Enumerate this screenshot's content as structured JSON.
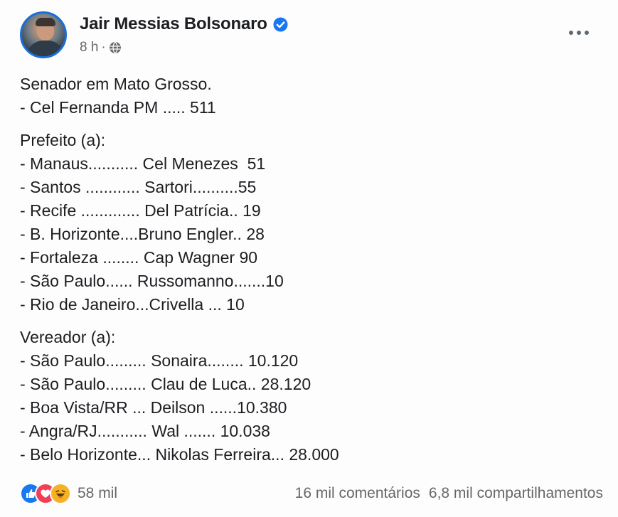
{
  "header": {
    "name": "Jair Messias Bolsonaro",
    "time": "8 h",
    "separator": "·"
  },
  "content": {
    "sections": [
      {
        "title": "Senador em Mato Grosso.",
        "lines": [
          "- Cel Fernanda PM ..... 511"
        ]
      },
      {
        "title": "Prefeito (a):",
        "lines": [
          "- Manaus........... Cel Menezes  51",
          "- Santos ............ Sartori..........55",
          "- Recife ............. Del Patrícia.. 19",
          "- B. Horizonte....Bruno Engler.. 28",
          "- Fortaleza ........ Cap Wagner 90",
          "- São Paulo...... Russomanno.......10",
          "- Rio de Janeiro...Crivella ... 10"
        ]
      },
      {
        "title": "Vereador (a):",
        "lines": [
          "- São Paulo......... Sonaira........ 10.120",
          "- São Paulo......... Clau de Luca.. 28.120",
          "- Boa Vista/RR ... Deilson ......10.380",
          "- Angra/RJ........... Wal ....... 10.038",
          "- Belo Horizonte... Nikolas Ferreira... 28.000"
        ]
      }
    ]
  },
  "footer": {
    "reaction_count": "58 mil",
    "comments": "16 mil comentários",
    "shares": "6,8 mil compartilhamentos",
    "reactions": [
      "like-icon",
      "love-icon",
      "haha-icon"
    ]
  },
  "colors": {
    "text": "#1c1e21",
    "meta": "#65676b",
    "verified": "#1877f2",
    "like": "#1877f2",
    "love": "#f33e58",
    "haha": "#f7b125"
  },
  "icons": {
    "verified": "verified-badge-icon",
    "globe": "globe-icon",
    "more": "more-options-icon"
  }
}
